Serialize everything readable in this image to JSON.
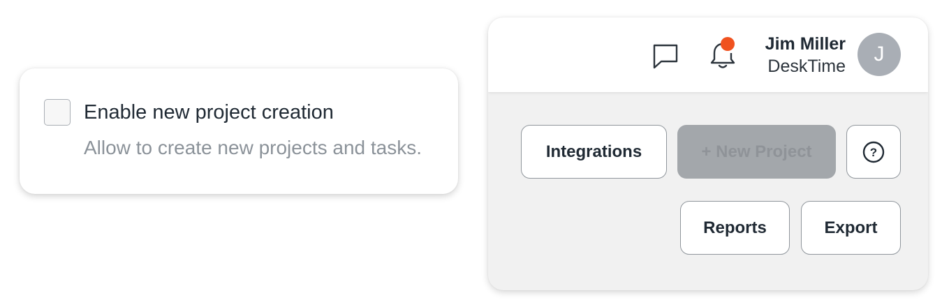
{
  "setting": {
    "title": "Enable new project creation",
    "description": "Allow to create new projects and tasks.",
    "checked": false
  },
  "header": {
    "user_name": "Jim Miller",
    "organization": "DeskTime",
    "avatar_initial": "J",
    "icons": [
      "chat-icon",
      "bell-icon"
    ],
    "notification_color": "#f0521f"
  },
  "actions": {
    "integrations_label": "Integrations",
    "new_project_label": "+ New Project",
    "help_label": "?",
    "reports_label": "Reports",
    "export_label": "Export"
  }
}
